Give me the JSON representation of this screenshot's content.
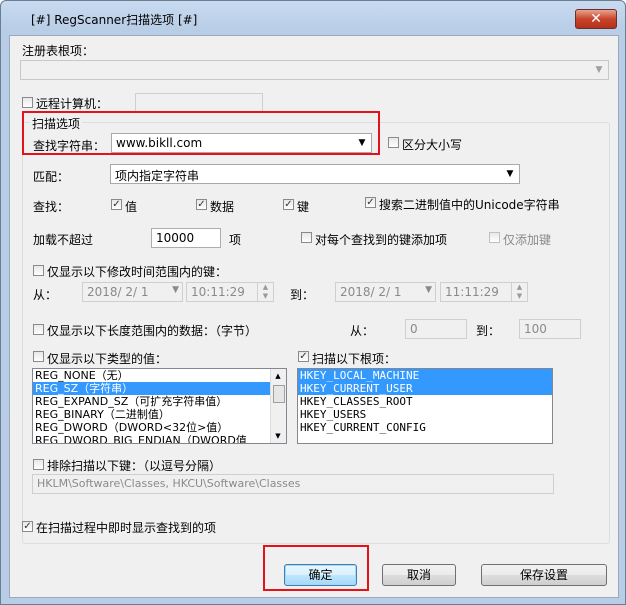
{
  "window": {
    "title": "[#] RegScanner扫描选项 [#]",
    "close_glyph": "✕"
  },
  "root_key": {
    "label": "注册表根项：",
    "value": ""
  },
  "remote": {
    "label": "远程计算机：",
    "value": ""
  },
  "scan_group": {
    "label": "扫描选项"
  },
  "find_string": {
    "label": "查找字符串：",
    "value": "www.bikll.com"
  },
  "case_sensitive": {
    "label": "区分大小写",
    "checked": false
  },
  "match": {
    "label": "匹配：",
    "value": "项内指定字符串"
  },
  "find": {
    "label": "查找：",
    "value_label": "值",
    "value_checked": true,
    "data_label": "数据",
    "data_checked": true,
    "key_label": "键",
    "key_checked": true,
    "unicode_label": "搜索二进制值中的Unicode字符串",
    "unicode_checked": true
  },
  "load_limit": {
    "label": "加载不超过",
    "value": "10000",
    "unit": "项"
  },
  "add_item": {
    "label": "对每个查找到的键添加项",
    "checked": false
  },
  "add_key_only": {
    "label": "仅添加键",
    "checked": false
  },
  "time_range": {
    "label": "仅显示以下修改时间范围内的键：",
    "from_label": "从：",
    "from_date": "2018/  2/  1",
    "from_time": "10:11:29",
    "to_label": "到：",
    "to_date": "2018/  2/  1",
    "to_time": "11:11:29"
  },
  "length_range": {
    "label": "仅显示以下长度范围内的数据：（字节）",
    "from_label": "从：",
    "from_value": "0",
    "to_label": "到：",
    "to_value": "100"
  },
  "types": {
    "label": "仅显示以下类型的值：",
    "items": [
      "REG_NONE（无）",
      "REG_SZ（字符串）",
      "REG_EXPAND_SZ（可扩充字符串值）",
      "REG_BINARY（二进制值）",
      "REG_DWORD（DWORD<32位>值）",
      "REG_DWORD_BIG_ENDIAN（DWORD值"
    ],
    "selected_index": 1
  },
  "roots": {
    "label": "扫描以下根项：",
    "checked": true,
    "items": [
      "HKEY_LOCAL_MACHINE",
      "HKEY_CURRENT_USER",
      "HKEY_CLASSES_ROOT",
      "HKEY_USERS",
      "HKEY_CURRENT_CONFIG"
    ],
    "selected": [
      0,
      1
    ]
  },
  "exclude": {
    "label": "排除扫描以下键：（以逗号分隔）",
    "value": "HKLM\\Software\\Classes, HKCU\\Software\\Classes"
  },
  "realtime": {
    "label": "在扫描过程中即时显示查找到的项",
    "checked": true
  },
  "buttons": {
    "ok": "确定",
    "cancel": "取消",
    "save": "保存设置"
  },
  "colors": {
    "highlight": "#e3121b",
    "selection": "#3399ff"
  }
}
